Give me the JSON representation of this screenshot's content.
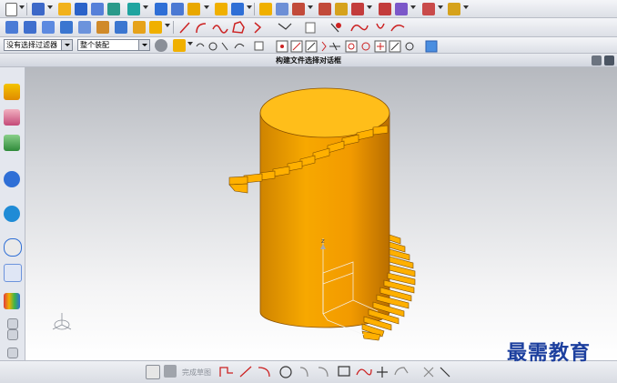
{
  "toolbar": {
    "selection_filter": "没有选择过滤器",
    "assembly_scope": "整个装配",
    "dialog_title": "构建文件选择对话框"
  },
  "sketch_toolbar": {
    "finish_sketch_label": "完成草图"
  },
  "watermark": {
    "text": "最需教育"
  },
  "colors": {
    "cylinder": "#f4a200",
    "cylinder_dark": "#d98a00",
    "cylinder_top": "#ffbe1a",
    "stair": "#ffb000",
    "watermark": "#1c3f9e"
  },
  "icons": {
    "left_bar": [
      "part-navigator-icon",
      "assembly-navigator-icon",
      "roles-icon",
      "info-icon",
      "history-icon",
      "clock-icon",
      "reuse-library-icon",
      "palette-icon",
      "scroll-up-icon",
      "scroll-down-icon"
    ],
    "view_triad": "coordinate-triad-icon"
  }
}
